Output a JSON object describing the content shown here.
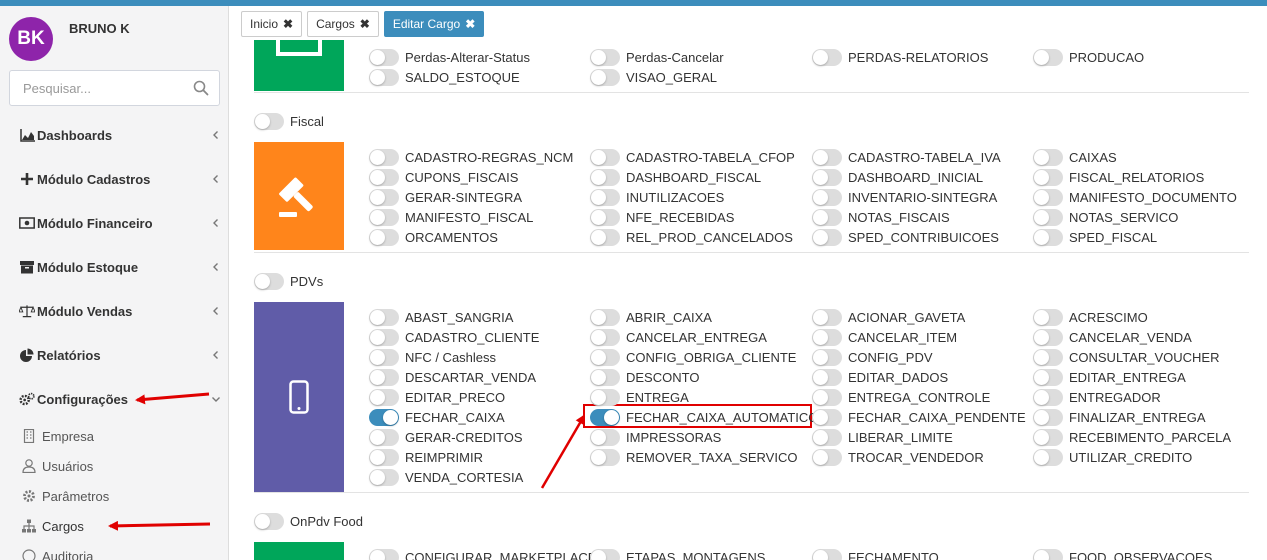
{
  "user": {
    "initials": "BK",
    "name": "BRUNO K"
  },
  "search": {
    "placeholder": "Pesquisar..."
  },
  "menu": [
    {
      "label": "Dashboards",
      "icon": "area-chart-icon"
    },
    {
      "label": "Módulo Cadastros",
      "icon": "plus-icon"
    },
    {
      "label": "Módulo Financeiro",
      "icon": "money-icon"
    },
    {
      "label": "Módulo Estoque",
      "icon": "archive-icon"
    },
    {
      "label": "Módulo Vendas",
      "icon": "balance-scale-icon"
    },
    {
      "label": "Relatórios",
      "icon": "pie-chart-icon"
    },
    {
      "label": "Configurações",
      "icon": "cogs-icon"
    }
  ],
  "submenu": [
    {
      "label": "Empresa",
      "icon": "building-icon"
    },
    {
      "label": "Usuários",
      "icon": "user-icon"
    },
    {
      "label": "Parâmetros",
      "icon": "gear-icon"
    },
    {
      "label": "Cargos",
      "icon": "sitemap-icon"
    },
    {
      "label": "Auditoria",
      "icon": "audit-icon"
    }
  ],
  "tabs": [
    {
      "label": "Inicio",
      "active": false
    },
    {
      "label": "Cargos",
      "active": false
    },
    {
      "label": "Editar Cargo",
      "active": true
    }
  ],
  "colors": {
    "accent": "#3c8dbc",
    "estoque": "#00a65a",
    "fiscal": "#ff851b",
    "pdvs": "#605ca8",
    "onpdv": "#00a65a",
    "highlight": "#e00000"
  },
  "groups": {
    "estoque": {
      "icon": "box-icon",
      "rows": [
        [
          "Perdas-Alterar-Status",
          "Perdas-Cancelar",
          "PERDAS-RELATORIOS",
          "PRODUCAO"
        ],
        [
          "SALDO_ESTOQUE",
          "VISAO_GERAL"
        ]
      ]
    },
    "fiscal": {
      "label": "Fiscal",
      "icon": "gavel-icon",
      "rows": [
        [
          "CADASTRO-REGRAS_NCM",
          "CADASTRO-TABELA_CFOP",
          "CADASTRO-TABELA_IVA",
          "CAIXAS"
        ],
        [
          "CUPONS_FISCAIS",
          "DASHBOARD_FISCAL",
          "DASHBOARD_INICIAL",
          "FISCAL_RELATORIOS"
        ],
        [
          "GERAR-SINTEGRA",
          "INUTILIZACOES",
          "INVENTARIO-SINTEGRA",
          "MANIFESTO_DOCUMENTO"
        ],
        [
          "MANIFESTO_FISCAL",
          "NFE_RECEBIDAS",
          "NOTAS_FISCAIS",
          "NOTAS_SERVICO"
        ],
        [
          "ORCAMENTOS",
          "REL_PROD_CANCELADOS",
          "SPED_CONTRIBUICOES",
          "SPED_FISCAL"
        ]
      ]
    },
    "pdvs": {
      "label": "PDVs",
      "icon": "mobile-icon",
      "rows": [
        [
          "ABAST_SANGRIA",
          "ABRIR_CAIXA",
          "ACIONAR_GAVETA",
          "ACRESCIMO"
        ],
        [
          "CADASTRO_CLIENTE",
          "CANCELAR_ENTREGA",
          "CANCELAR_ITEM",
          "CANCELAR_VENDA"
        ],
        [
          "NFC / Cashless",
          "CONFIG_OBRIGA_CLIENTE",
          "CONFIG_PDV",
          "CONSULTAR_VOUCHER"
        ],
        [
          "DESCARTAR_VENDA",
          "DESCONTO",
          "EDITAR_DADOS",
          "EDITAR_ENTREGA"
        ],
        [
          "EDITAR_PRECO",
          "ENTREGA",
          "ENTREGA_CONTROLE",
          "ENTREGADOR"
        ],
        [
          "FECHAR_CAIXA",
          "FECHAR_CAIXA_AUTOMATICO",
          "FECHAR_CAIXA_PENDENTE",
          "FINALIZAR_ENTREGA"
        ],
        [
          "GERAR-CREDITOS",
          "IMPRESSORAS",
          "LIBERAR_LIMITE",
          "RECEBIMENTO_PARCELA"
        ],
        [
          "REIMPRIMIR",
          "REMOVER_TAXA_SERVICO",
          "TROCAR_VENDEDOR",
          "UTILIZAR_CREDITO"
        ],
        [
          "VENDA_CORTESIA"
        ]
      ],
      "enabled": [
        "FECHAR_CAIXA",
        "FECHAR_CAIXA_AUTOMATICO"
      ]
    },
    "onpdv": {
      "label": "OnPdv Food",
      "rows": [
        [
          "CONFIGURAR_MARKETPLACES",
          "ETAPAS_MONTAGENS",
          "FECHAMENTO",
          "FOOD_OBSERVACOES"
        ]
      ]
    }
  }
}
